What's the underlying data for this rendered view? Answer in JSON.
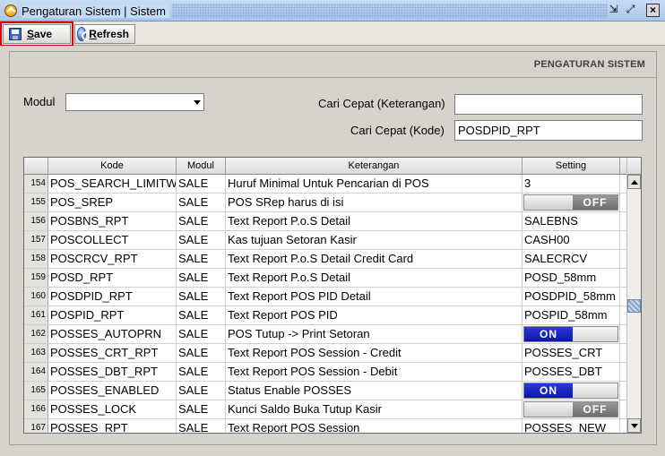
{
  "window": {
    "title": "Pengaturan Sistem | Sistem"
  },
  "toolbar": {
    "save_prefix": "S",
    "save_rest": "ave",
    "refresh_prefix": "R",
    "refresh_rest": "efresh"
  },
  "section": {
    "title": "PENGATURAN SISTEM"
  },
  "form": {
    "modul_label": "Modul",
    "modul_value": "",
    "cari_keterangan_label": "Cari Cepat (Keterangan)",
    "cari_keterangan_value": "",
    "cari_kode_label": "Cari Cepat (Kode)",
    "cari_kode_value": "POSDPID_RPT"
  },
  "grid": {
    "columns": [
      "",
      "Kode",
      "Modul",
      "Keterangan",
      "Setting"
    ],
    "rows": [
      {
        "no": "154",
        "kode": "POS_SEARCH_LIMITW",
        "modul": "SALE",
        "ket": "Huruf Minimal Untuk Pencarian di POS",
        "setting": "3",
        "type": "text"
      },
      {
        "no": "155",
        "kode": "POS_SREP",
        "modul": "SALE",
        "ket": "POS SRep harus di isi",
        "setting": "OFF",
        "type": "off"
      },
      {
        "no": "156",
        "kode": "POSBNS_RPT",
        "modul": "SALE",
        "ket": "Text Report P.o.S Detail",
        "setting": "SALEBNS",
        "type": "text"
      },
      {
        "no": "157",
        "kode": "POSCOLLECT",
        "modul": "SALE",
        "ket": "Kas tujuan Setoran Kasir",
        "setting": "CASH00",
        "type": "text"
      },
      {
        "no": "158",
        "kode": "POSCRCV_RPT",
        "modul": "SALE",
        "ket": "Text Report P.o.S Detail Credit Card",
        "setting": "SALECRCV",
        "type": "text"
      },
      {
        "no": "159",
        "kode": "POSD_RPT",
        "modul": "SALE",
        "ket": "Text Report P.o.S Detail",
        "setting": "POSD_58mm",
        "type": "text"
      },
      {
        "no": "160",
        "kode": "POSDPID_RPT",
        "modul": "SALE",
        "ket": "Text Report POS PID Detail",
        "setting": "POSDPID_58mm",
        "type": "text"
      },
      {
        "no": "161",
        "kode": "POSPID_RPT",
        "modul": "SALE",
        "ket": "Text Report POS PID",
        "setting": "POSPID_58mm",
        "type": "text"
      },
      {
        "no": "162",
        "kode": "POSSES_AUTOPRN",
        "modul": "SALE",
        "ket": "POS Tutup -> Print Setoran",
        "setting": "ON",
        "type": "on"
      },
      {
        "no": "163",
        "kode": "POSSES_CRT_RPT",
        "modul": "SALE",
        "ket": "Text Report POS Session - Credit",
        "setting": "POSSES_CRT",
        "type": "text"
      },
      {
        "no": "164",
        "kode": "POSSES_DBT_RPT",
        "modul": "SALE",
        "ket": "Text Report POS Session - Debit",
        "setting": "POSSES_DBT",
        "type": "text"
      },
      {
        "no": "165",
        "kode": "POSSES_ENABLED",
        "modul": "SALE",
        "ket": "Status Enable POSSES",
        "setting": "ON",
        "type": "on"
      },
      {
        "no": "166",
        "kode": "POSSES_LOCK",
        "modul": "SALE",
        "ket": "Kunci Saldo Buka Tutup Kasir",
        "setting": "OFF",
        "type": "off"
      },
      {
        "no": "167",
        "kode": "POSSES_RPT",
        "modul": "SALE",
        "ket": "Text Report POS Session",
        "setting": "POSSES_NEW",
        "type": "text"
      }
    ]
  }
}
